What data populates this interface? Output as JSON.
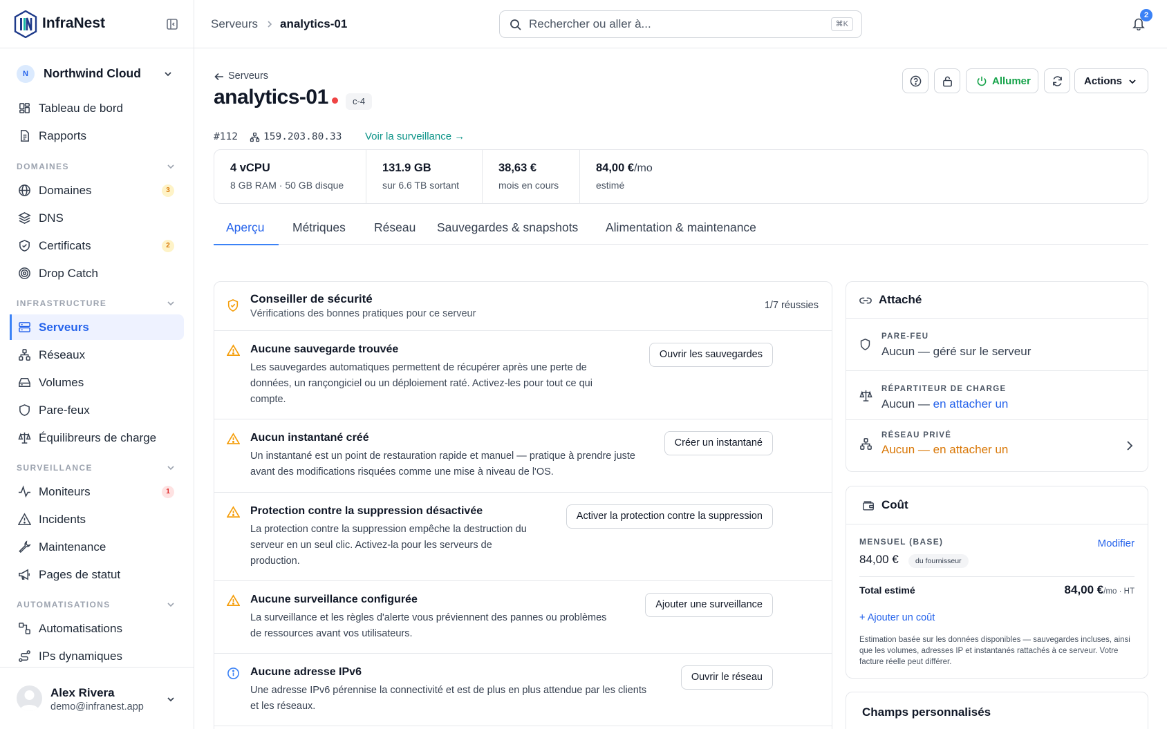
{
  "brand": {
    "name": "InfraNest"
  },
  "org": {
    "initial": "N",
    "name": "Northwind Cloud"
  },
  "nav": {
    "top": [
      {
        "label": "Tableau de bord",
        "icon": "dashboard-icon"
      },
      {
        "label": "Rapports",
        "icon": "report-icon"
      }
    ],
    "sections": {
      "domaines": "DOMAINES",
      "infrastructure": "INFRASTRUCTURE",
      "surveillance": "SURVEILLANCE",
      "automatisations": "AUTOMATISATIONS"
    },
    "domaines": [
      {
        "label": "Domaines",
        "badge": "3"
      },
      {
        "label": "DNS"
      },
      {
        "label": "Certificats",
        "badge": "2"
      },
      {
        "label": "Drop Catch"
      }
    ],
    "infrastructure": [
      {
        "label": "Serveurs",
        "active": true
      },
      {
        "label": "Réseaux"
      },
      {
        "label": "Volumes"
      },
      {
        "label": "Pare-feux"
      },
      {
        "label": "Équilibreurs de charge"
      }
    ],
    "surveillance": [
      {
        "label": "Moniteurs",
        "badge": "1"
      },
      {
        "label": "Incidents"
      },
      {
        "label": "Maintenance"
      },
      {
        "label": "Pages de statut"
      }
    ],
    "automatisations": [
      {
        "label": "Automatisations"
      },
      {
        "label": "IPs dynamiques"
      }
    ]
  },
  "user": {
    "name": "Alex Rivera",
    "email": "demo@infranest.app"
  },
  "topbar": {
    "breadcrumb_parent": "Serveurs",
    "breadcrumb_current": "analytics-01",
    "search_placeholder": "Rechercher ou aller à...",
    "search_shortcut": "⌘K",
    "notifications_count": "2"
  },
  "server": {
    "back_label": "Serveurs",
    "name": "analytics-01",
    "status_color": "#ef4444",
    "plan": "c-4",
    "id": "#112",
    "ip": "159.203.80.33",
    "monitoring_link": "Voir la surveillance →"
  },
  "header_actions": {
    "power_label": "Allumer",
    "actions_label": "Actions"
  },
  "stats": [
    {
      "value": "4 vCPU",
      "sub": "8 GB RAM · 50 GB disque"
    },
    {
      "value": "131.9 GB",
      "sub": "sur 6.6 TB sortant"
    },
    {
      "value": "38,63 €",
      "sub": "mois en cours"
    },
    {
      "value": "84,00 €",
      "value_suffix": "/mo",
      "sub": "estimé"
    }
  ],
  "tabs": [
    {
      "label": "Aperçu",
      "active": true
    },
    {
      "label": "Métriques"
    },
    {
      "label": "Réseau"
    },
    {
      "label": "Sauvegardes & snapshots"
    },
    {
      "label": "Alimentation & maintenance"
    }
  ],
  "security": {
    "title": "Conseiller de sécurité",
    "subtitle": "Vérifications des bonnes pratiques pour ce serveur",
    "score": "1/7 réussies",
    "checks": [
      {
        "title": "Aucune sauvegarde trouvée",
        "lines": [
          "Les sauvegardes automatiques permettent de récupérer après une perte de",
          "données, un rançongiciel ou un déploiement raté. Activez-les pour tout ce qui",
          "compte."
        ],
        "action": "Ouvrir les sauvegardes",
        "level": "warning"
      },
      {
        "title": "Aucun instantané créé",
        "lines": [
          "Un instantané est un point de restauration rapide et manuel — pratique à prendre juste",
          "avant des modifications risquées comme une mise à niveau de l'OS."
        ],
        "action": "Créer un instantané",
        "level": "warning"
      },
      {
        "title": "Protection contre la suppression désactivée",
        "lines": [
          "La protection contre la suppression empêche la destruction du",
          "serveur en un seul clic. Activez-la pour les serveurs de",
          "production."
        ],
        "action": "Activer la protection contre la suppression",
        "level": "warning"
      },
      {
        "title": "Aucune surveillance configurée",
        "lines": [
          "La surveillance et les règles d'alerte vous préviennent des pannes ou problèmes",
          "de ressources avant vos utilisateurs."
        ],
        "action": "Ajouter une surveillance",
        "level": "warning"
      },
      {
        "title": "Aucune adresse IPv6",
        "lines": [
          "Une adresse IPv6 pérennise la connectivité et est de plus en plus attendue par les clients",
          "et les réseaux."
        ],
        "action": "Ouvrir le réseau",
        "level": "info"
      }
    ]
  },
  "attached": {
    "title": "Attaché",
    "firewall": {
      "label": "PARE-FEU",
      "value": "Aucun — géré sur le serveur"
    },
    "load_balancer": {
      "label": "RÉPARTITEUR DE CHARGE",
      "value_prefix": "Aucun — ",
      "link": "en attacher un"
    },
    "private_network": {
      "label": "RÉSEAU PRIVÉ",
      "value": "Aucun — en attacher un"
    }
  },
  "cost": {
    "title": "Coût",
    "monthly_label": "MENSUEL (BASE)",
    "edit_label": "Modifier",
    "monthly_value": "84,00 €",
    "source_tag": "du fournisseur",
    "total_label": "Total estimé",
    "total_value": "84,00 €",
    "total_suffix": "/mo · HT",
    "add_label": "+ Ajouter un coût",
    "note": "Estimation basée sur les données disponibles — sauvegardes incluses, ainsi que les volumes, adresses IP et instantanés rattachés à ce serveur. Votre facture réelle peut différer."
  },
  "custom_fields": {
    "title": "Champs personnalisés"
  },
  "colors": {
    "accent": "#3b82f6",
    "success": "#16a34a",
    "warning": "#f59e0b",
    "danger": "#ef4444",
    "link": "#2563eb"
  }
}
